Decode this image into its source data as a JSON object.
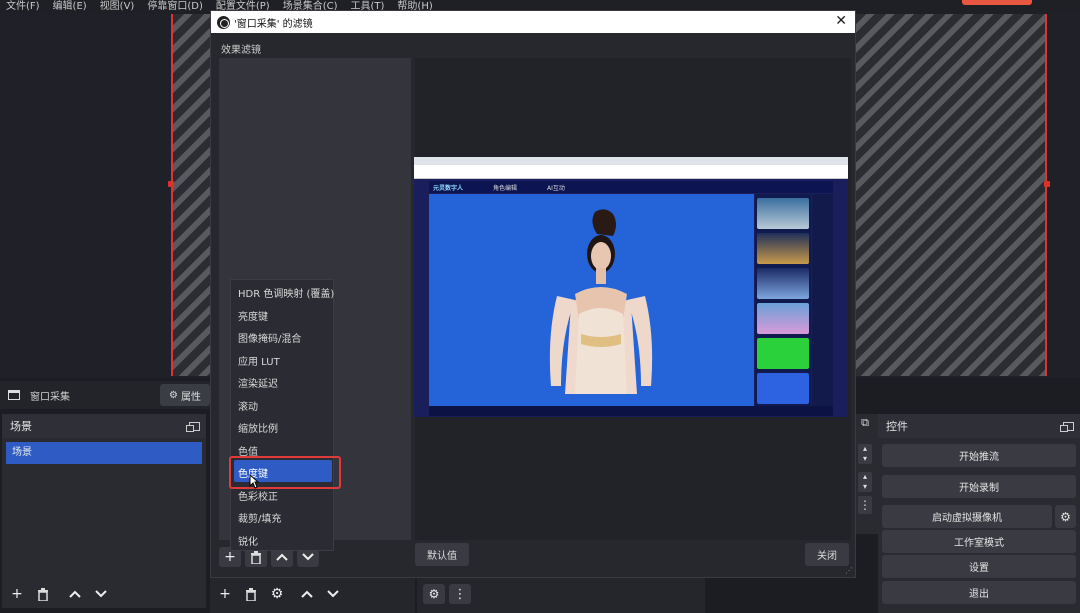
{
  "menubar": {
    "items": [
      "文件(F)",
      "编辑(E)",
      "视图(V)",
      "停靠窗口(D)",
      "配置文件(P)",
      "场景集合(C)",
      "工具(T)",
      "帮助(H)"
    ]
  },
  "source_toolbar": {
    "source_name": "窗口采集",
    "properties_label": "属性"
  },
  "scenes": {
    "title": "场景",
    "items": [
      "场景"
    ]
  },
  "controls": {
    "title": "控件",
    "buttons": [
      "开始推流",
      "开始录制",
      "启动虚拟摄像机",
      "工作室模式",
      "设置",
      "退出"
    ]
  },
  "dialog": {
    "title": "'窗口采集' 的滤镜",
    "effects_label": "效果滤镜",
    "defaults_label": "默认值",
    "close_label": "关闭"
  },
  "filter_menu": {
    "items": [
      "HDR 色调映射 (覆盖)",
      "亮度键",
      "图像掩码/混合",
      "应用 LUT",
      "渲染延迟",
      "滚动",
      "缩放比例",
      "色值",
      "色度键",
      "色彩校正",
      "裁剪/填充",
      "锐化"
    ],
    "selected": "色度键"
  },
  "capture_preview": {
    "app_title": "元灵数字人",
    "tab1": "角色编辑",
    "tab2": "AI互动"
  },
  "colors": {
    "accent": "#2e5bc4",
    "highlight_box": "#e03a3a",
    "scene_outline": "#dd3333"
  }
}
